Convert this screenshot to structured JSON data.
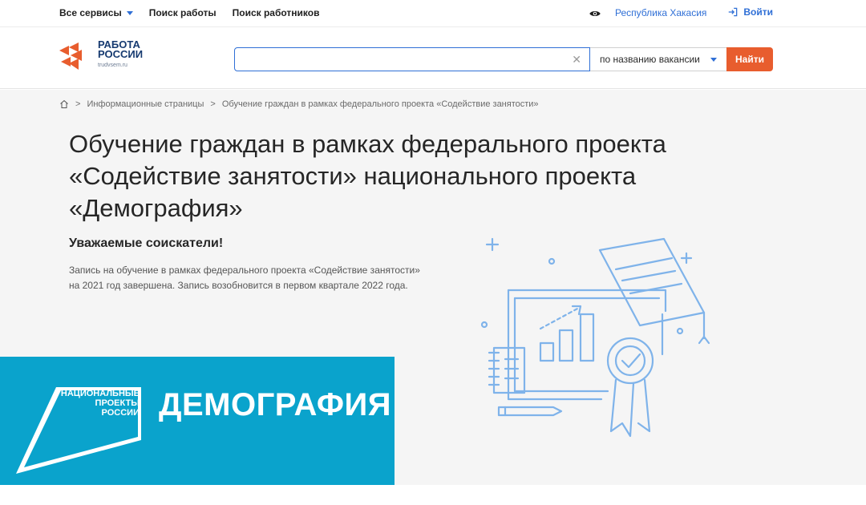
{
  "topbar": {
    "all_services": "Все сервисы",
    "job_search": "Поиск работы",
    "worker_search": "Поиск работников",
    "region": "Республика Хакасия",
    "login": "Войти"
  },
  "logo": {
    "line1": "РАБОТА",
    "line2": "РОССИИ",
    "domain": "trudvsem.ru"
  },
  "search": {
    "value": "",
    "placeholder": "",
    "mode": "по названию вакансии",
    "button": "Найти"
  },
  "breadcrumb": {
    "section": "Информационные страницы",
    "current": "Обучение граждан в рамках федерального проекта «Содействие занятости»"
  },
  "content": {
    "title": "Обучение граждан в рамках федерального проекта «Содействие занятости» национального проекта «Демография»",
    "subtitle": "Уважаемые соискатели!",
    "description": "Запись на обучение в рамках федерального проекта «Содействие занятости» на 2021 год завершена. Запись возобновится в первом квартале 2022 года."
  },
  "banner": {
    "np_line1": "НАЦИОНАЛЬНЫЕ",
    "np_line2": "ПРОЕКТЫ",
    "np_line3": "РОССИИ",
    "headline": "ДЕМОГРАФИЯ"
  },
  "colors": {
    "accent": "#2f6fd6",
    "button": "#e85d2e",
    "banner": "#0aa3cc",
    "illustration": "#7fb3ea"
  }
}
